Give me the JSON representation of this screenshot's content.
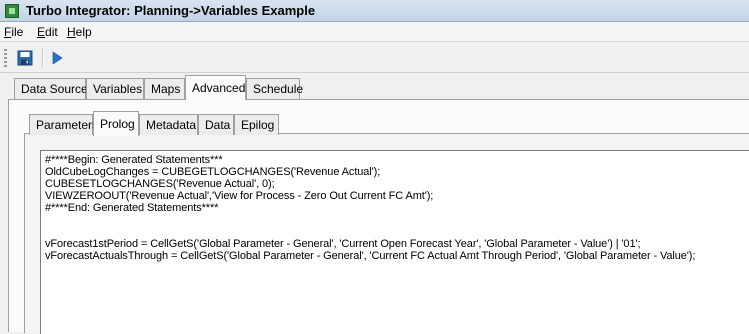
{
  "window": {
    "title": "Turbo Integrator: Planning->Variables Example"
  },
  "menu": [
    {
      "label_hotkey": "F",
      "label_rest": "ile"
    },
    {
      "label_hotkey": "E",
      "label_rest": "dit"
    },
    {
      "label_hotkey": "H",
      "label_rest": "elp"
    }
  ],
  "toolbar": {
    "save_icon": "save-icon",
    "run_icon": "run-icon"
  },
  "outer_tabs": [
    "Data Source",
    "Variables",
    "Maps",
    "Advanced",
    "Schedule"
  ],
  "outer_active": "Advanced",
  "inner_tabs": [
    "Parameters",
    "Prolog",
    "Metadata",
    "Data",
    "Epilog"
  ],
  "inner_active": "Prolog",
  "code": [
    "#****Begin: Generated Statements***",
    "OldCubeLogChanges = CUBEGETLOGCHANGES('Revenue Actual');",
    "CUBESETLOGCHANGES('Revenue Actual', 0);",
    "VIEWZEROOUT('Revenue Actual','View for Process - Zero Out Current FC Amt');",
    "#****End: Generated Statements****",
    "",
    "",
    "vForecast1stPeriod = CellGetS('Global Parameter - General', 'Current Open Forecast Year', 'Global Parameter - Value') | '01';",
    "vForecastActualsThrough = CellGetS('Global Parameter - General', 'Current FC Actual Amt Through Period', 'Global Parameter - Value');"
  ]
}
